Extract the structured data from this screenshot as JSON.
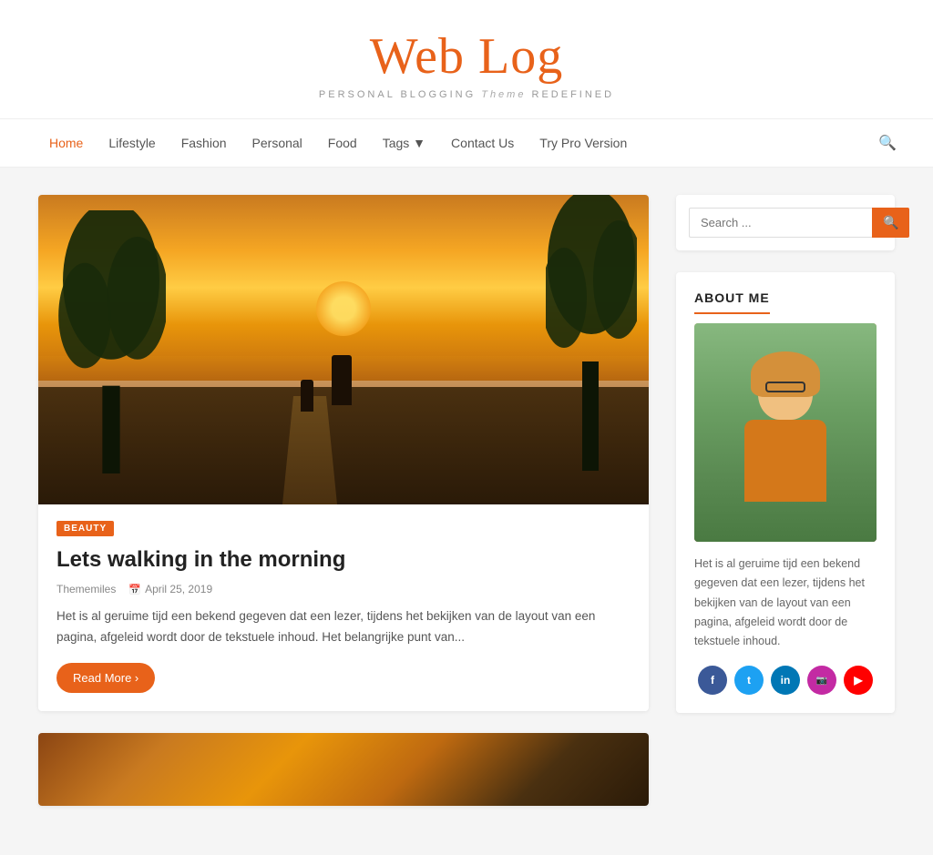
{
  "site": {
    "title": "Web Log",
    "subtitle_plain": "PERSONAL BLOGGING",
    "subtitle_italic": "Theme",
    "subtitle_after": "REDEFINED"
  },
  "nav": {
    "items": [
      {
        "label": "Home",
        "active": true
      },
      {
        "label": "Lifestyle",
        "active": false
      },
      {
        "label": "Fashion",
        "active": false
      },
      {
        "label": "Personal",
        "active": false
      },
      {
        "label": "Food",
        "active": false
      },
      {
        "label": "Tags",
        "active": false,
        "has_dropdown": true
      },
      {
        "label": "Contact Us",
        "active": false
      },
      {
        "label": "Try Pro Version",
        "active": false
      }
    ]
  },
  "posts": [
    {
      "category": "BEAUTY",
      "title": "Lets walking in the morning",
      "author": "Thememiles",
      "date": "April 25, 2019",
      "excerpt": "Het is al geruime tijd een bekend gegeven dat een lezer, tijdens het bekijken van de layout van een pagina, afgeleid wordt door de tekstuele inhoud. Het belangrijke punt van...",
      "read_more": "Read More ›"
    }
  ],
  "sidebar": {
    "search_placeholder": "Search ...",
    "search_button_label": "🔍",
    "about_title": "ABOUT ME",
    "about_text": "Het is al geruime tijd een bekend gegeven dat een lezer, tijdens het bekijken van de layout van een pagina, afgeleid wordt door de tekstuele inhoud.",
    "social": [
      {
        "name": "facebook",
        "label": "f"
      },
      {
        "name": "twitter",
        "label": "t"
      },
      {
        "name": "linkedin",
        "label": "in"
      },
      {
        "name": "instagram",
        "label": "📷"
      },
      {
        "name": "youtube",
        "label": "▶"
      }
    ]
  }
}
